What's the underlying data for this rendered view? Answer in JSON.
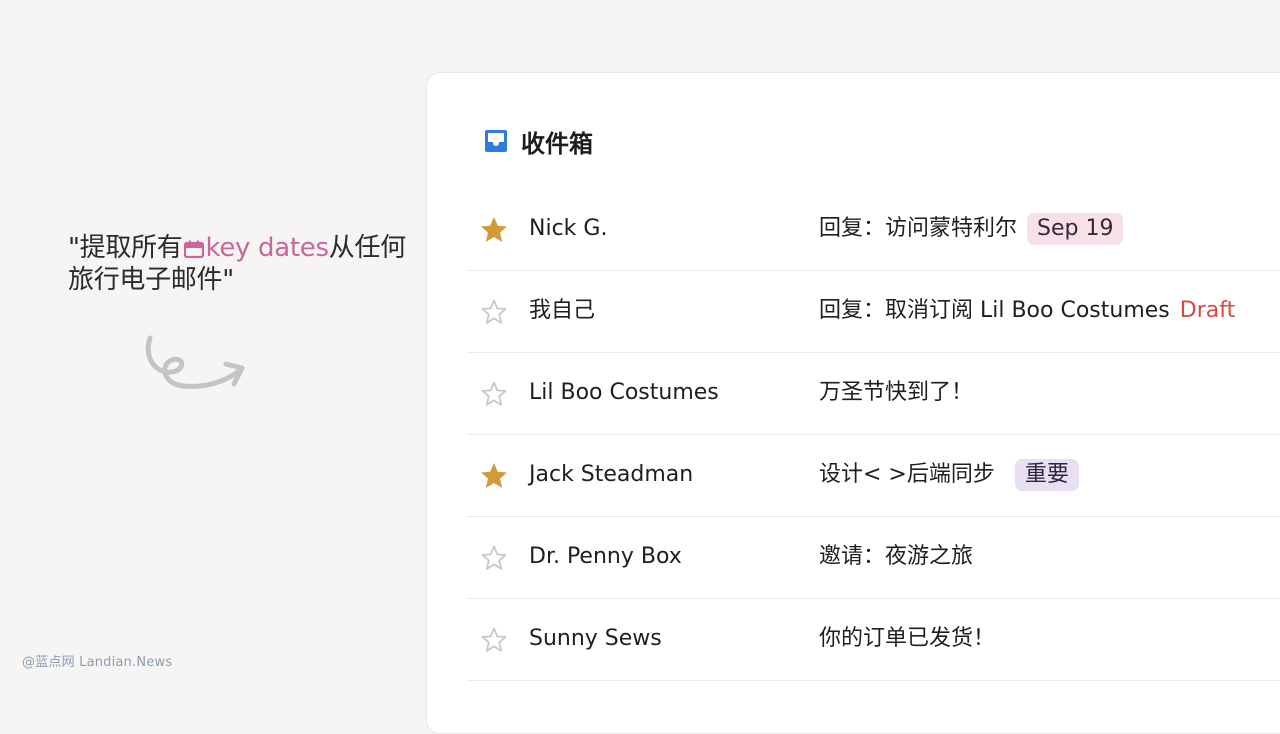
{
  "prompt": {
    "open_quote": "\"",
    "text_before": "提取所有",
    "highlight": "key dates",
    "text_after": "从任何旅行电子邮件",
    "close_quote": "\""
  },
  "watermark": "@蓝点网 Landian.News",
  "inbox": {
    "title": "收件箱",
    "emails": [
      {
        "starred": true,
        "sender": "Nick G.",
        "subject": "回复：访问蒙特利尔",
        "tag": "Sep 19",
        "tag_type": "date"
      },
      {
        "starred": false,
        "sender": "我自己",
        "subject": "回复：取消订阅 Lil Boo Costumes",
        "draft": "Draft"
      },
      {
        "starred": false,
        "sender": "Lil Boo Costumes",
        "subject": "万圣节快到了！"
      },
      {
        "starred": true,
        "sender": "Jack Steadman",
        "subject": "设计< >后端同步",
        "tag": "重要",
        "tag_type": "important"
      },
      {
        "starred": false,
        "sender": "Dr. Penny Box",
        "subject": "邀请：夜游之旅"
      },
      {
        "starred": false,
        "sender": "Sunny Sews",
        "subject": "你的订单已发货！"
      }
    ]
  },
  "colors": {
    "star_filled": "#d29b35",
    "star_empty": "#c8c8c8",
    "inbox_icon": "#2f7ce0",
    "highlight": "#c9669c",
    "draft": "#d8493f"
  }
}
